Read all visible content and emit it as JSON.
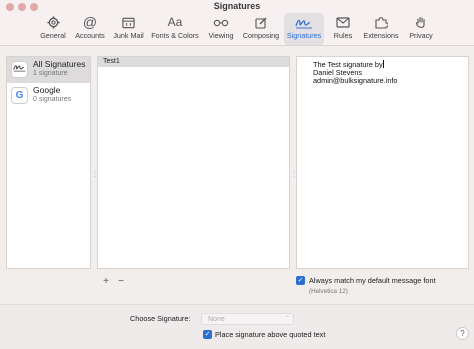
{
  "window": {
    "title": "Signatures"
  },
  "toolbar": {
    "items": [
      {
        "label": "General",
        "icon": "gear-icon"
      },
      {
        "label": "Accounts",
        "icon": "at-icon"
      },
      {
        "label": "Junk Mail",
        "icon": "trash-tray-icon"
      },
      {
        "label": "Fonts & Colors",
        "icon": "font-icon",
        "glyph": "Aa"
      },
      {
        "label": "Viewing",
        "icon": "glasses-icon"
      },
      {
        "label": "Composing",
        "icon": "pencil-icon"
      },
      {
        "label": "Signatures",
        "icon": "signature-icon",
        "active": true
      },
      {
        "label": "Rules",
        "icon": "envelope-rules-icon"
      },
      {
        "label": "Extensions",
        "icon": "puzzle-icon"
      },
      {
        "label": "Privacy",
        "icon": "hand-icon"
      }
    ],
    "active_color": "#2a6fd6"
  },
  "accounts": [
    {
      "name": "All Signatures",
      "count": "1 signature",
      "icon": "signature-icon"
    },
    {
      "name": "Google",
      "count": "0 signatures",
      "icon": "google-icon"
    }
  ],
  "signatures": {
    "items": [
      "Test1"
    ]
  },
  "editor": {
    "lines": [
      "The Test signature by",
      "Daniel Stevens",
      "admin@bulksignature.info"
    ]
  },
  "options": {
    "always_match_label": "Always match my default message font",
    "always_match_checked": true,
    "font_hint": "(Helvetica 12)",
    "choose_label": "Choose Signature:",
    "choose_value": "None",
    "place_above_label": "Place signature above quoted text",
    "place_above_checked": true
  },
  "buttons": {
    "add": "+",
    "remove": "−",
    "help": "?"
  }
}
